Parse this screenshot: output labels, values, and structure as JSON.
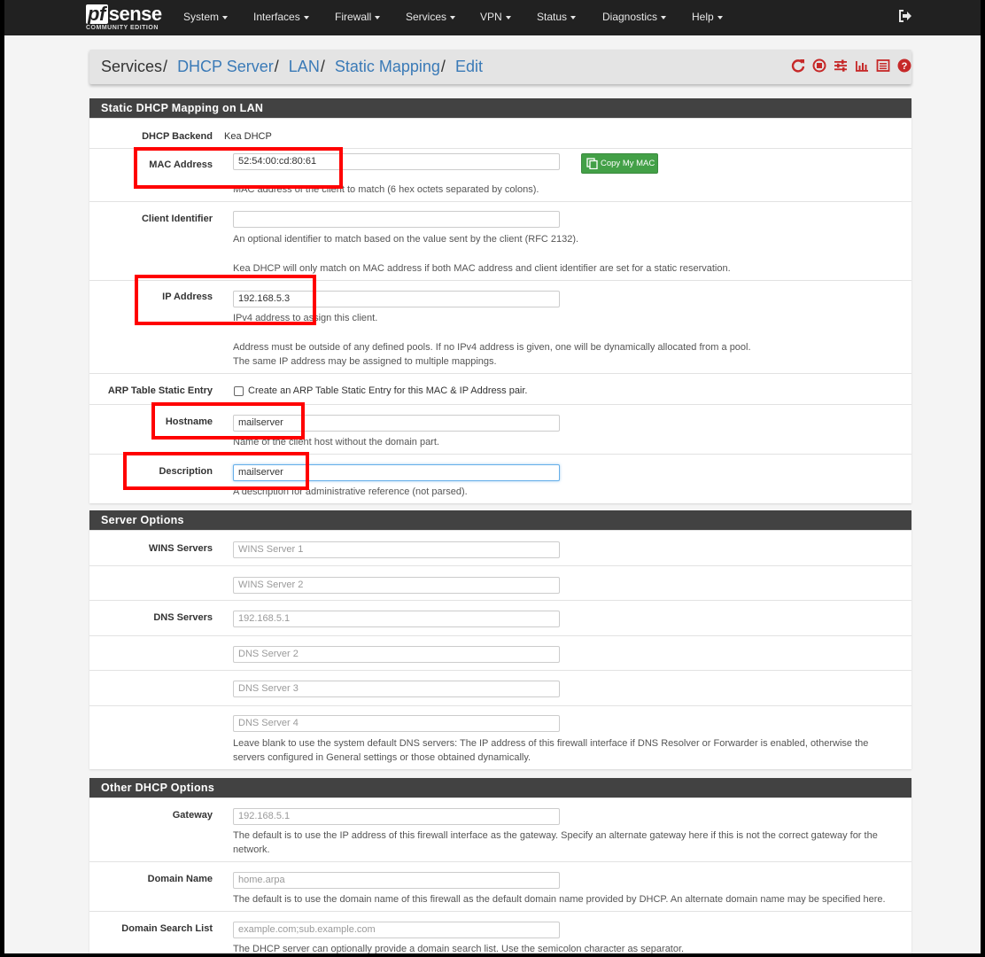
{
  "brand": {
    "name_prefix": "pf",
    "name_suffix": "sense",
    "edition": "COMMUNITY EDITION"
  },
  "nav": {
    "items": [
      {
        "label": "System"
      },
      {
        "label": "Interfaces"
      },
      {
        "label": "Firewall"
      },
      {
        "label": "Services"
      },
      {
        "label": "VPN"
      },
      {
        "label": "Status"
      },
      {
        "label": "Diagnostics"
      },
      {
        "label": "Help"
      }
    ],
    "logout_icon": "sign-out-icon"
  },
  "breadcrumb": {
    "items": [
      "Services",
      "DHCP Server",
      "LAN",
      "Static Mapping",
      "Edit"
    ],
    "separator": "/",
    "icons": [
      "refresh-icon",
      "stop-circle-icon",
      "sliders-icon",
      "bar-chart-icon",
      "list-alt-icon",
      "question-circle-icon"
    ],
    "icon_color": "#c62828"
  },
  "static_mapping": {
    "heading": "Static DHCP Mapping on LAN",
    "dhcp_backend": {
      "label": "DHCP Backend",
      "value": "Kea DHCP"
    },
    "mac_address": {
      "label": "MAC Address",
      "value": "52:54:00:cd:80:61",
      "button": "Copy My MAC",
      "help": "MAC address of the client to match (6 hex octets separated by colons)."
    },
    "client_identifier": {
      "label": "Client Identifier",
      "value": "",
      "help1": "An optional identifier to match based on the value sent by the client (RFC 2132).",
      "help2": "Kea DHCP will only match on MAC address if both MAC address and client identifier are set for a static reservation."
    },
    "ip_address": {
      "label": "IP Address",
      "value": "192.168.5.3",
      "help1": "IPv4 address to assign this client.",
      "help2": "Address must be outside of any defined pools. If no IPv4 address is given, one will be dynamically allocated from a pool.",
      "help3": "The same IP address may be assigned to multiple mappings."
    },
    "arp": {
      "label": "ARP Table Static Entry",
      "checked": false,
      "checkbox_label": "Create an ARP Table Static Entry for this MAC & IP Address pair."
    },
    "hostname": {
      "label": "Hostname",
      "value": "mailserver",
      "help": "Name of the client host without the domain part."
    },
    "description": {
      "label": "Description",
      "value": "mailserver",
      "help": "A description for administrative reference (not parsed)."
    }
  },
  "server_options": {
    "heading": "Server Options",
    "wins_label": "WINS Servers",
    "wins1_placeholder": "WINS Server 1",
    "wins2_placeholder": "WINS Server 2",
    "dns_label": "DNS Servers",
    "dns1_placeholder": "192.168.5.1",
    "dns2_placeholder": "DNS Server 2",
    "dns3_placeholder": "DNS Server 3",
    "dns4_placeholder": "DNS Server 4",
    "dns_help1": "Leave blank to use the system default DNS servers: The IP address of this firewall interface if DNS Resolver or Forwarder is enabled, otherwise the",
    "dns_help2": "servers configured in General settings or those obtained dynamically."
  },
  "other_options": {
    "heading": "Other DHCP Options",
    "gateway": {
      "label": "Gateway",
      "placeholder": "192.168.5.1",
      "help1": "The default is to use the IP address of this firewall interface as the gateway. Specify an alternate gateway here if this is not the correct gateway for the",
      "help2": "network."
    },
    "domain_name": {
      "label": "Domain Name",
      "placeholder": "home.arpa",
      "help": "The default is to use the domain name of this firewall as the default domain name provided by DHCP. An alternate domain name may be specified here."
    },
    "domain_search": {
      "label": "Domain Search List",
      "placeholder": "example.com;sub.example.com",
      "help": "The DHCP server can optionally provide a domain search list. Use the semicolon character as separator."
    }
  },
  "colors": {
    "navbar": "#212121",
    "panel_heading": "#424242",
    "link": "#3a7ab7",
    "annotation": "#ff0000",
    "button_green": "#43a047"
  }
}
